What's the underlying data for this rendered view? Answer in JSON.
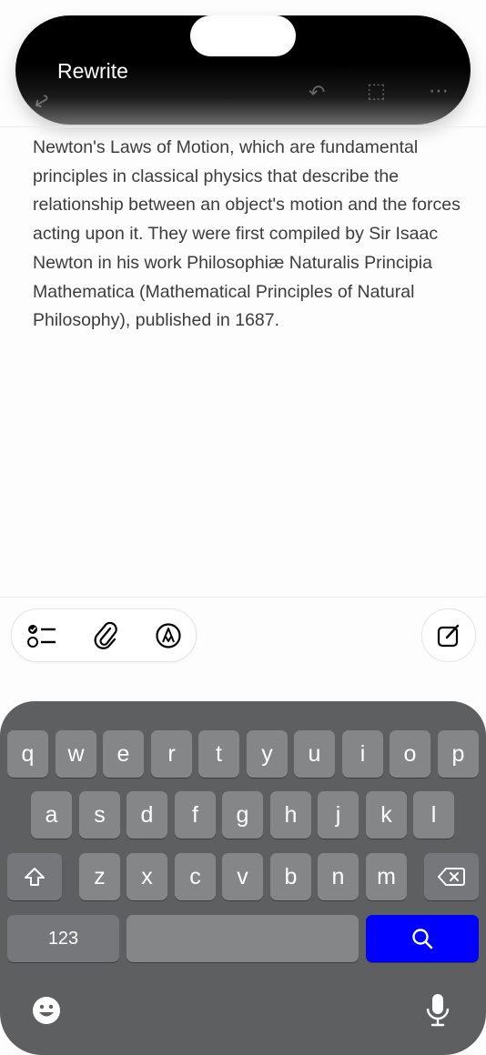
{
  "banner": {
    "title": "Rewrite"
  },
  "note": {
    "body": "Newton's Laws of Motion, which are fundamental principles in classical physics that describe the relationship between an object's motion and the forces acting upon it. They were first compiled by Sir Isaac Newton in his work Philosophiæ Naturalis Principia Mathematica (Mathematical Principles of Natural Philosophy), published in 1687."
  },
  "toolbar": {
    "items": [
      {
        "icon": "checklist-icon"
      },
      {
        "icon": "paperclip-icon"
      },
      {
        "icon": "markup-pen-icon"
      }
    ],
    "compose_icon": "compose-icon"
  },
  "keyboard": {
    "row1": [
      "q",
      "w",
      "e",
      "r",
      "t",
      "y",
      "u",
      "i",
      "o",
      "p"
    ],
    "row2": [
      "a",
      "s",
      "d",
      "f",
      "g",
      "h",
      "j",
      "k",
      "l"
    ],
    "row3": [
      "z",
      "x",
      "c",
      "v",
      "b",
      "n",
      "m"
    ],
    "numbers_label": "123",
    "shift_icon": "shift-icon",
    "delete_icon": "delete-icon",
    "search_icon": "search-icon",
    "emoji_icon": "emoji-icon",
    "mic_icon": "microphone-icon",
    "accent_color": "#0000ff"
  }
}
